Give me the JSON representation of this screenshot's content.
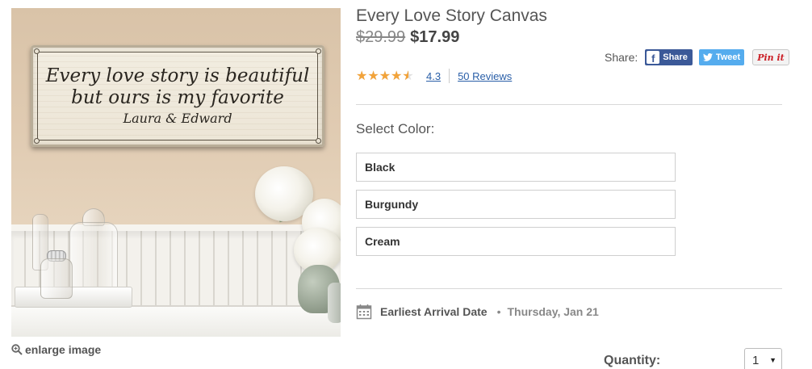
{
  "product": {
    "title": "Every Love Story Canvas",
    "old_price": "$29.99",
    "new_price": "$17.99",
    "image": {
      "sign_line1": "Every love story is beautiful",
      "sign_line2": "but ours is my favorite",
      "sign_names": "Laura & Edward"
    },
    "enlarge_label": "enlarge image"
  },
  "share": {
    "label": "Share:",
    "facebook_label": "Share",
    "twitter_label": "Tweet",
    "pinterest_label": "Pin it",
    "colors": {
      "facebook": "#3b5998",
      "twitter": "#55acee",
      "pinterest": "#cb2027"
    }
  },
  "rating": {
    "value": "4.3",
    "stars_fraction": 0.86,
    "reviews_label": "50 Reviews",
    "star_color": "#f2a33a"
  },
  "color_select": {
    "label": "Select Color:",
    "options": [
      "Black",
      "Burgundy",
      "Cream"
    ]
  },
  "arrival": {
    "label": "Earliest Arrival Date",
    "date": "Thursday, Jan 21"
  },
  "quantity": {
    "label": "Quantity:",
    "value": "1"
  }
}
